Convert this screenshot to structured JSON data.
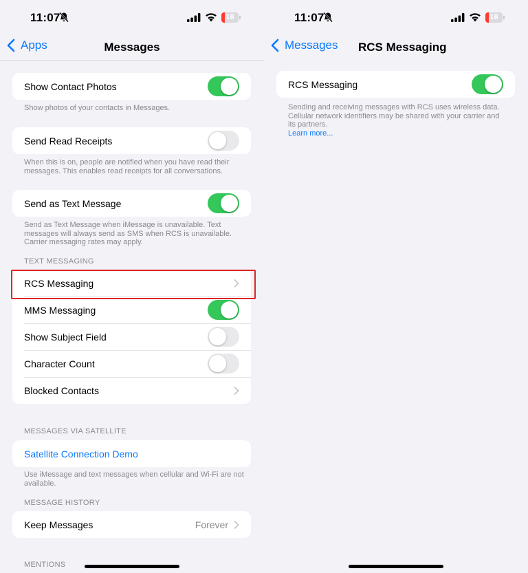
{
  "status_bar": {
    "time": "11:07",
    "battery": "18",
    "battery_level": 0.18
  },
  "left": {
    "nav": {
      "back_label": "Apps",
      "title": "Messages"
    },
    "groups": [
      {
        "rows": [
          {
            "label": "Show Contact Photos",
            "toggle": true
          }
        ],
        "footer": "Show photos of your contacts in Messages."
      },
      {
        "rows": [
          {
            "label": "Send Read Receipts",
            "toggle": false
          }
        ],
        "footer": "When this is on, people are notified when you have read their messages. This enables read receipts for all conversations."
      },
      {
        "rows": [
          {
            "label": "Send as Text Message",
            "toggle": true
          }
        ],
        "footer": "Send as Text Message when iMessage is unavailable. Text messages will always send as SMS when RCS is unavailable. Carrier messaging rates may apply."
      }
    ],
    "text_messaging": {
      "header": "TEXT MESSAGING",
      "rows": [
        {
          "label": "RCS Messaging",
          "type": "disclosure"
        },
        {
          "label": "MMS Messaging",
          "type": "toggle",
          "on": true
        },
        {
          "label": "Show Subject Field",
          "type": "toggle",
          "on": false
        },
        {
          "label": "Character Count",
          "type": "toggle",
          "on": false
        },
        {
          "label": "Blocked Contacts",
          "type": "disclosure"
        }
      ]
    },
    "satellite": {
      "header": "MESSAGES VIA SATELLITE",
      "row_label": "Satellite Connection Demo",
      "footer": "Use iMessage and text messages when cellular and Wi-Fi are not available."
    },
    "history": {
      "header": "MESSAGE HISTORY",
      "row_label": "Keep Messages",
      "row_value": "Forever"
    },
    "mentions_header": "MENTIONS"
  },
  "right": {
    "nav": {
      "back_label": "Messages",
      "title": "RCS Messaging"
    },
    "row_label": "RCS Messaging",
    "toggle": true,
    "footer": "Sending and receiving messages with RCS uses wireless data. Cellular network identifiers may be shared with your carrier and its partners.",
    "learn_more": "Learn more..."
  },
  "colors": {
    "accent": "#0a7aff",
    "toggle_on": "#34c759",
    "highlight": "#e02424"
  }
}
